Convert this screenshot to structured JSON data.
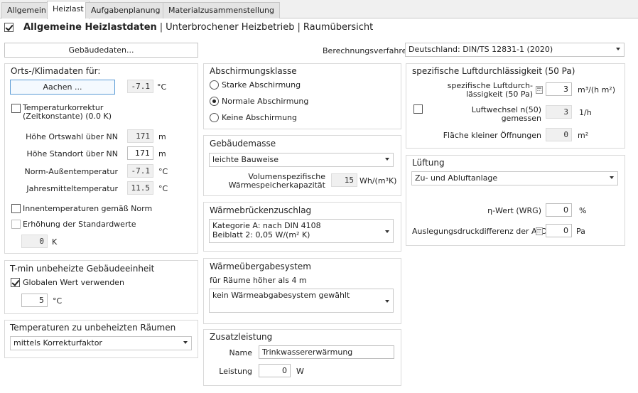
{
  "tabs": [
    "Allgemein",
    "Heizlast",
    "Aufgabenplanung",
    "Materialzusammenstellung"
  ],
  "header": {
    "title": "Allgemeine Heizlastdaten",
    "link1": "Unterbrochener Heizbetrieb",
    "link2": "Raumübersicht",
    "sep": "|"
  },
  "building_button": "Gebäudedaten...",
  "calc_method": {
    "label": "Berechnungsverfahren",
    "value": "Deutschland: DIN/TS 12831-1 (2020)"
  },
  "location": {
    "title": "Orts-/Klimadaten für:",
    "city_button": "Aachen ...",
    "city_temp": "-7.1",
    "unit_c": "°C",
    "tempcorr_label": "Temperaturkorrektur",
    "tempcorr_label2": "(Zeitkonstante) (0.0 K)",
    "rows": [
      {
        "label": "Höhe Ortswahl über NN",
        "value": "171",
        "unit": "m"
      },
      {
        "label": "Höhe Standort über NN",
        "value": "171",
        "unit": "m"
      },
      {
        "label": "Norm-Außentemperatur",
        "value": "-7.1",
        "unit": "°C"
      },
      {
        "label": "Jahresmitteltemperatur",
        "value": "11.5",
        "unit": "°C"
      }
    ],
    "inner_temp_label": "Innentemperaturen gemäß Norm",
    "raise_label": "Erhöhung der Standardwerte",
    "raise_value": "0",
    "raise_unit": "K"
  },
  "tmin": {
    "title": "T-min unbeheizte Gebäudeeinheit",
    "global_label": "Globalen Wert verwenden",
    "value": "5",
    "unit": "°C"
  },
  "unheated": {
    "title": "Temperaturen zu unbeheizten Räumen",
    "value": "mittels Korrekturfaktor"
  },
  "shielding": {
    "title": "Abschirmungsklasse",
    "options": [
      "Starke Abschirmung",
      "Normale Abschirmung",
      "Keine Abschirmung"
    ],
    "selected": 1
  },
  "mass": {
    "title": "Gebäudemasse",
    "value": "leichte Bauweise",
    "cap_label1": "Volumenspezifische",
    "cap_label2": "Wärmespeicherkapazität",
    "cap_value": "15",
    "cap_unit": "Wh/(m³K)"
  },
  "bridge": {
    "title": "Wärmebrückenzuschlag",
    "line1": "Kategorie A: nach DIN 4108",
    "line2": "Beiblatt 2: 0,05 W/(m² K)"
  },
  "transfer": {
    "title": "Wärmeübergabesystem",
    "sub": "für Räume höher als 4 m",
    "value": "kein Wärmeabgabesystem gewählt"
  },
  "extra": {
    "title": "Zusatzleistung",
    "name_label": "Name",
    "name_value": "Trinkwassererwärmung",
    "power_label": "Leistung",
    "power_value": "0",
    "power_unit": "W"
  },
  "permeability": {
    "title": "spezifische Luftdurchlässigkeit (50 Pa)",
    "spec_label1": "spezifische Luftdurch-",
    "spec_label2": "lässigkeit (50 Pa)",
    "spec_value": "3",
    "spec_unit": "m³/(h m²)",
    "n50_label1": "Luftwechsel n(50)",
    "n50_label2": "gemessen",
    "n50_value": "3",
    "n50_unit": "1/h",
    "small_label": "Fläche kleiner Öffnungen",
    "small_value": "0",
    "small_unit": "m²"
  },
  "ventilation": {
    "title": "Lüftung",
    "value": "Zu- und Abluftanlage",
    "eta_label": "η-Wert (WRG)",
    "eta_value": "0",
    "eta_unit": "%",
    "ald_label": "Auslegungsdruckdifferenz der ALD",
    "ald_value": "0",
    "ald_unit": "Pa"
  }
}
